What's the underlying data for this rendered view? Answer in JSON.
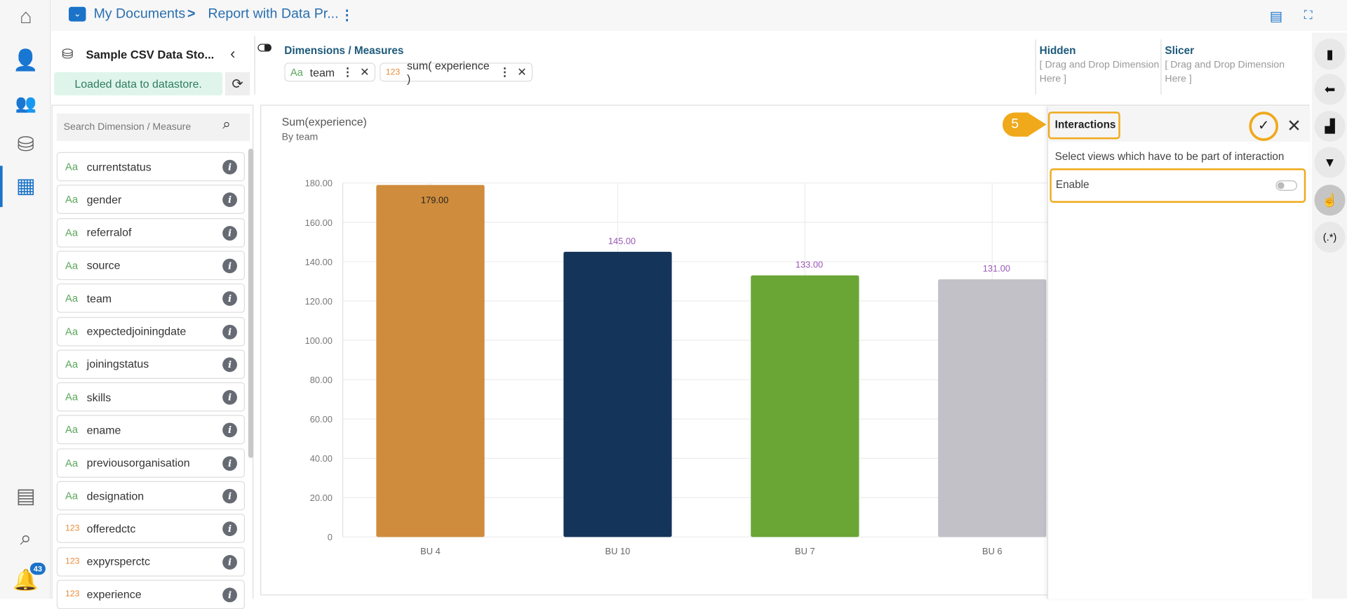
{
  "nav": {
    "items": [
      "home",
      "user-settings",
      "users",
      "datastore",
      "dashboard-designer",
      "data-catalog",
      "data-search",
      "notifications"
    ],
    "notification_count": "43"
  },
  "header": {
    "breadcrumb_root": "My Documents",
    "breadcrumb_sep": ">",
    "report_title": "Report with Data Pr..."
  },
  "datastore": {
    "title": "Sample CSV Data Sto...",
    "status": "Loaded data to datastore."
  },
  "dims": {
    "title": "Dimensions / Measures",
    "chips": [
      {
        "type": "Aa",
        "label": "team"
      },
      {
        "type": "123",
        "label": "sum( experience )"
      }
    ]
  },
  "hidden": {
    "title": "Hidden",
    "placeholder": "[ Drag and Drop Dimension Here ]"
  },
  "slicer": {
    "title": "Slicer",
    "placeholder": "[ Drag and Drop Dimension Here ]"
  },
  "fields": {
    "search_placeholder": "Search Dimension / Measure",
    "items": [
      {
        "type": "Aa",
        "label": "currentstatus"
      },
      {
        "type": "Aa",
        "label": "gender"
      },
      {
        "type": "Aa",
        "label": "referralof"
      },
      {
        "type": "Aa",
        "label": "source"
      },
      {
        "type": "Aa",
        "label": "team"
      },
      {
        "type": "Aa",
        "label": "expectedjoiningdate"
      },
      {
        "type": "Aa",
        "label": "joiningstatus"
      },
      {
        "type": "Aa",
        "label": "skills"
      },
      {
        "type": "Aa",
        "label": "ename"
      },
      {
        "type": "Aa",
        "label": "previousorganisation"
      },
      {
        "type": "Aa",
        "label": "designation"
      },
      {
        "type": "123",
        "label": "offeredctc"
      },
      {
        "type": "123",
        "label": "expyrsperctc"
      },
      {
        "type": "123",
        "label": "experience"
      }
    ]
  },
  "interactions": {
    "step": "5",
    "title": "Interactions",
    "description": "Select views which have to be part of interaction",
    "enable_label": "Enable",
    "enabled": false
  },
  "rail": {
    "regex_label": "(.*)"
  },
  "chart_data": {
    "type": "bar",
    "title": "Sum(experience)",
    "subtitle": "By team",
    "categories": [
      "BU 4",
      "BU 10",
      "BU 7",
      "BU 6"
    ],
    "values": [
      179,
      145,
      133,
      131
    ],
    "labels": [
      "179.00",
      "145.00",
      "133.00",
      "131.00"
    ],
    "colors": [
      "#cf8c3c",
      "#14345a",
      "#6aa636",
      "#c3c1c8"
    ],
    "ylim": [
      0,
      180
    ],
    "yticks": [
      "0",
      "20.00",
      "40.00",
      "60.00",
      "80.00",
      "100.00",
      "120.00",
      "140.00",
      "160.00",
      "180.00"
    ],
    "label_color": "#9b59b6"
  }
}
